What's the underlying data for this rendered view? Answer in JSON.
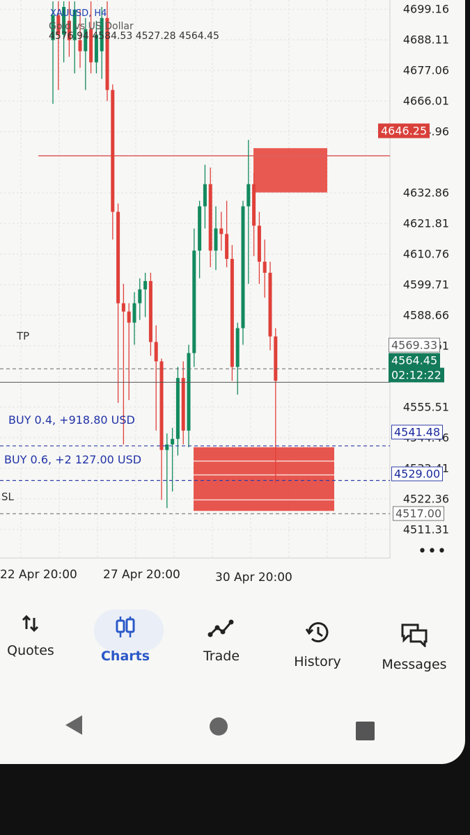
{
  "symbol": {
    "name": "XAUUSD, H4",
    "description": "Gold vs US Dollar",
    "ohlc": "4576.94 4584.53 4527.28 4564.45"
  },
  "colors": {
    "bull": "#138a5e",
    "bear": "#e0403a",
    "zone": "#e5483f",
    "order_line": "#2d3da8",
    "tp_sl_line": "#666666",
    "alert_line": "#e05c5c",
    "accent": "#2a58c8"
  },
  "price_axis": {
    "ticks": [
      "4699.16",
      "4688.11",
      "4677.06",
      "4666.01",
      "4654.96",
      "4632.86",
      "4621.81",
      "4610.76",
      "4599.71",
      "4588.66",
      "4577.61",
      "4555.51",
      "4544.46",
      "4533.41",
      "4522.36",
      "4511.31"
    ],
    "min": 4506,
    "max": 4702
  },
  "chart_data": {
    "type": "candlestick",
    "timeframe": "H4",
    "x_labels": [
      "22 Apr 20:00",
      "27 Apr 20:00",
      "30 Apr 20:00"
    ],
    "candles": [
      {
        "o": 4688,
        "h": 4702,
        "l": 4665,
        "c": 4697
      },
      {
        "o": 4697,
        "h": 4702,
        "l": 4670,
        "c": 4690
      },
      {
        "o": 4690,
        "h": 4702,
        "l": 4680,
        "c": 4700
      },
      {
        "o": 4695,
        "h": 4702,
        "l": 4682,
        "c": 4688
      },
      {
        "o": 4688,
        "h": 4702,
        "l": 4676,
        "c": 4699
      },
      {
        "o": 4688,
        "h": 4699,
        "l": 4678,
        "c": 4684
      },
      {
        "o": 4684,
        "h": 4696,
        "l": 4670,
        "c": 4692
      },
      {
        "o": 4692,
        "h": 4702,
        "l": 4676,
        "c": 4680
      },
      {
        "o": 4680,
        "h": 4695,
        "l": 4676,
        "c": 4690
      },
      {
        "o": 4684,
        "h": 4700,
        "l": 4674,
        "c": 4696
      },
      {
        "o": 4696,
        "h": 4702,
        "l": 4666,
        "c": 4670
      },
      {
        "o": 4670,
        "h": 4672,
        "l": 4616,
        "c": 4626
      },
      {
        "o": 4626,
        "h": 4629,
        "l": 4557,
        "c": 4593
      },
      {
        "o": 4593,
        "h": 4600,
        "l": 4542,
        "c": 4590
      },
      {
        "o": 4590,
        "h": 4593,
        "l": 4558,
        "c": 4586
      },
      {
        "o": 4586,
        "h": 4597,
        "l": 4578,
        "c": 4593
      },
      {
        "o": 4593,
        "h": 4602,
        "l": 4587,
        "c": 4598
      },
      {
        "o": 4598,
        "h": 4604,
        "l": 4588,
        "c": 4601
      },
      {
        "o": 4601,
        "h": 4604,
        "l": 4574,
        "c": 4579
      },
      {
        "o": 4579,
        "h": 4585,
        "l": 4547,
        "c": 4572
      },
      {
        "o": 4572,
        "h": 4573,
        "l": 4522,
        "c": 4540
      },
      {
        "o": 4540,
        "h": 4546,
        "l": 4519,
        "c": 4542
      },
      {
        "o": 4542,
        "h": 4548,
        "l": 4525,
        "c": 4544
      },
      {
        "o": 4544,
        "h": 4570,
        "l": 4538,
        "c": 4566
      },
      {
        "o": 4566,
        "h": 4572,
        "l": 4542,
        "c": 4547
      },
      {
        "o": 4547,
        "h": 4578,
        "l": 4541,
        "c": 4575
      },
      {
        "o": 4575,
        "h": 4620,
        "l": 4570,
        "c": 4612
      },
      {
        "o": 4612,
        "h": 4630,
        "l": 4602,
        "c": 4628
      },
      {
        "o": 4628,
        "h": 4643,
        "l": 4620,
        "c": 4636
      },
      {
        "o": 4636,
        "h": 4642,
        "l": 4606,
        "c": 4612
      },
      {
        "o": 4612,
        "h": 4628,
        "l": 4605,
        "c": 4620
      },
      {
        "o": 4620,
        "h": 4626,
        "l": 4612,
        "c": 4618
      },
      {
        "o": 4618,
        "h": 4630,
        "l": 4606,
        "c": 4609
      },
      {
        "o": 4609,
        "h": 4614,
        "l": 4565,
        "c": 4570
      },
      {
        "o": 4570,
        "h": 4586,
        "l": 4560,
        "c": 4584
      },
      {
        "o": 4584,
        "h": 4630,
        "l": 4578,
        "c": 4628
      },
      {
        "o": 4628,
        "h": 4652,
        "l": 4600,
        "c": 4636
      },
      {
        "o": 4636,
        "h": 4640,
        "l": 4610,
        "c": 4621
      },
      {
        "o": 4621,
        "h": 4626,
        "l": 4600,
        "c": 4608
      },
      {
        "o": 4608,
        "h": 4616,
        "l": 4595,
        "c": 4604
      },
      {
        "o": 4604,
        "h": 4608,
        "l": 4576,
        "c": 4581
      },
      {
        "o": 4581,
        "h": 4584,
        "l": 4528,
        "c": 4565
      }
    ]
  },
  "alert_price": "4646.25",
  "alert_hidden": "4643.91",
  "tp_price": "4569.33",
  "current_price": "4564.45",
  "countdown": "02:12:22",
  "tp_label": "TP",
  "sl_label": "SL",
  "sl_price": "4517.00",
  "orders": [
    {
      "label": "BUY 0.4,  +918.80 USD",
      "price": "4541.48"
    },
    {
      "label": "BUY 0.6,  +2 127.00 USD",
      "price": "4529.00"
    }
  ],
  "more_label": "•••",
  "nav": [
    {
      "label": "Quotes",
      "icon": "sort-arrows-icon"
    },
    {
      "label": "Charts",
      "icon": "candles-icon"
    },
    {
      "label": "Trade",
      "icon": "trade-line-icon"
    },
    {
      "label": "History",
      "icon": "history-icon"
    },
    {
      "label": "Messages",
      "icon": "messages-icon"
    }
  ]
}
